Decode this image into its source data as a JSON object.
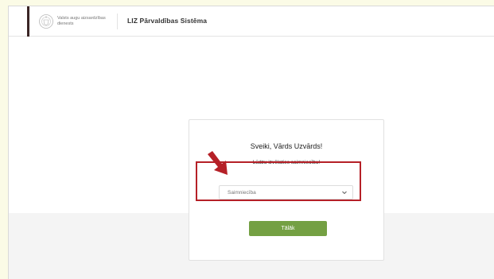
{
  "header": {
    "org_name": "Valsts augu aizsardzības dienests",
    "app_title": "LIZ Pārvaldības Sistēma"
  },
  "card": {
    "greeting": "Sveiki, Vārds Uzvārds!",
    "prompt": "Lūdzu izvēlaties saimniecību!",
    "select": {
      "value": "Saimniecība",
      "icon": "chevron-down-icon"
    },
    "next_button_label": "Tālāk"
  },
  "colors": {
    "brand_bar": "#3a2525",
    "button_green": "#74a043",
    "annotation_red": "#b52027",
    "page_background": "#fbfbe6"
  }
}
